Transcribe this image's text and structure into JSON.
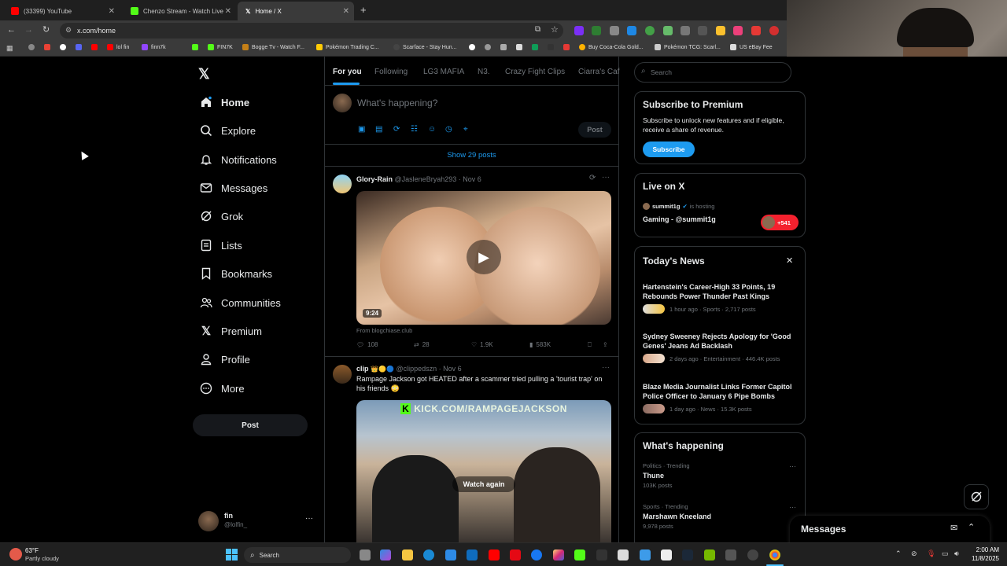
{
  "browser": {
    "tabs": [
      {
        "title": "(33399) YouTube",
        "color": "#ff0000"
      },
      {
        "title": "Chenzo Stream - Watch Live on",
        "color": "#53fc18"
      },
      {
        "title": "Home / X",
        "color": "#ffffff"
      }
    ],
    "new_tab": "+",
    "url": "x.com/home",
    "bookmarks": [
      "lol fin",
      "finn7k",
      "FIN7K",
      "Bogge Tv - Watch F...",
      "Pokémon Trading C...",
      "Scarface - Stay Hun...",
      "Buy Coca-Cola Gold...",
      "Pokémon TCG: Scarl...",
      "US eBay Fee Calc"
    ]
  },
  "nav": {
    "items": [
      {
        "label": "Home",
        "icon": "home-icon"
      },
      {
        "label": "Explore",
        "icon": "search-icon"
      },
      {
        "label": "Notifications",
        "icon": "bell-icon"
      },
      {
        "label": "Messages",
        "icon": "envelope-icon"
      },
      {
        "label": "Grok",
        "icon": "grok-icon"
      },
      {
        "label": "Lists",
        "icon": "list-icon"
      },
      {
        "label": "Bookmarks",
        "icon": "bookmark-icon"
      },
      {
        "label": "Communities",
        "icon": "people-icon"
      },
      {
        "label": "Premium",
        "icon": "x-logo-icon"
      },
      {
        "label": "Profile",
        "icon": "person-icon"
      },
      {
        "label": "More",
        "icon": "more-circle-icon"
      }
    ],
    "post_label": "Post",
    "account": {
      "name": "fin",
      "handle": "@lolfin_"
    }
  },
  "feed_tabs": [
    "For you",
    "Following",
    "LG3 MAFIA",
    "N3.",
    "Crazy Fight Clips",
    "Ciarra's Caf"
  ],
  "composer": {
    "placeholder": "What's happening?",
    "post_label": "Post"
  },
  "show_posts": "Show 29 posts",
  "tweets": [
    {
      "name": "Glory-Rain",
      "handle": "@JasleneBryah293",
      "date": "· Nov 6",
      "duration": "9:24",
      "source": "From blogchiase.club",
      "replies": "108",
      "reposts": "28",
      "likes": "1.9K",
      "views": "583K"
    },
    {
      "name": "clip",
      "handle": "@clippedszn",
      "date": "· Nov 6",
      "text": "Rampage Jackson got HEATED after a scammer tried pulling a 'tourist trap' on his friends 😳",
      "overlay_text": "KICK.COM/RAMPAGEJACKSON",
      "watch_again": "Watch again"
    }
  ],
  "sidebar": {
    "search_placeholder": "Search",
    "premium": {
      "title": "Subscribe to Premium",
      "body": "Subscribe to unlock new features and if eligible, receive a share of revenue.",
      "button": "Subscribe"
    },
    "live": {
      "title": "Live on X",
      "host": "summit1g",
      "hosting": "is hosting",
      "stream": "Gaming - @summit1g",
      "count": "+541"
    },
    "news": {
      "title": "Today's News",
      "items": [
        {
          "headline": "Hartenstein's Career-High 33 Points, 19 Rebounds Power Thunder Past Kings",
          "meta": "1 hour ago · Sports · 2,717 posts"
        },
        {
          "headline": "Sydney Sweeney Rejects Apology for 'Good Genes' Jeans Ad Backlash",
          "meta": "2 days ago · Entertainment · 446.4K posts"
        },
        {
          "headline": "Blaze Media Journalist Links Former Capitol Police Officer to January 6 Pipe Bombs",
          "meta": "1 day ago · News · 15.3K posts"
        }
      ]
    },
    "happening": {
      "title": "What's happening",
      "items": [
        {
          "category": "Politics · Trending",
          "topic": "Thune",
          "posts": "103K posts"
        },
        {
          "category": "Sports · Trending",
          "topic": "Marshawn Kneeland",
          "posts": "9,978 posts"
        }
      ]
    }
  },
  "messages_drawer": "Messages",
  "taskbar": {
    "weather_temp": "63°F",
    "weather_desc": "Partly cloudy",
    "search": "Search",
    "time": "2:00 AM",
    "date": "11/8/2025"
  }
}
